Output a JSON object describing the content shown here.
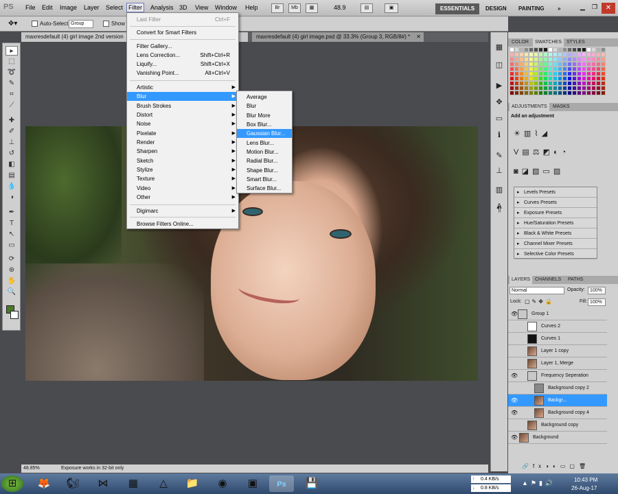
{
  "app": {
    "logo": "PS"
  },
  "menu": [
    "File",
    "Edit",
    "Image",
    "Layer",
    "Select",
    "Filter",
    "Analysis",
    "3D",
    "View",
    "Window",
    "Help"
  ],
  "menubar_right": {
    "br": "Br",
    "mb": "Mb",
    "zoom": "48.9",
    "workspaces": [
      "ESSENTIALS",
      "DESIGN",
      "PAINTING",
      "»"
    ]
  },
  "options": {
    "auto_select_label": "Auto-Select:",
    "auto_select_value": "Group",
    "show_label": "Show T"
  },
  "tabs": [
    {
      "label": "maxresdefault (4) girl image 2nd version"
    },
    {
      "label": "maxresdefault (4) girl image.psd @ 33.3% (Group 3, RGB/8#) *"
    }
  ],
  "filter_menu": {
    "items": [
      {
        "label": "Last Filter",
        "shortcut": "Ctrl+F"
      },
      {
        "label": "Convert for Smart Filters"
      },
      {
        "label": "Filter Gallery..."
      },
      {
        "label": "Lens Correction...",
        "shortcut": "Shift+Ctrl+R"
      },
      {
        "label": "Liquify...",
        "shortcut": "Shift+Ctrl+X"
      },
      {
        "label": "Vanishing Point...",
        "shortcut": "Alt+Ctrl+V"
      },
      {
        "label": "Artistic"
      },
      {
        "label": "Blur"
      },
      {
        "label": "Brush Strokes"
      },
      {
        "label": "Distort"
      },
      {
        "label": "Noise"
      },
      {
        "label": "Pixelate"
      },
      {
        "label": "Render"
      },
      {
        "label": "Sharpen"
      },
      {
        "label": "Sketch"
      },
      {
        "label": "Stylize"
      },
      {
        "label": "Texture"
      },
      {
        "label": "Video"
      },
      {
        "label": "Other"
      },
      {
        "label": "Digimarc"
      },
      {
        "label": "Browse Filters Online..."
      }
    ]
  },
  "blur_menu": [
    "Average",
    "Blur",
    "Blur More",
    "Box Blur...",
    "Gaussian Blur...",
    "Lens Blur...",
    "Motion Blur...",
    "Radial Blur...",
    "Shape Blur...",
    "Smart Blur...",
    "Surface Blur..."
  ],
  "panels": {
    "color_tabs": [
      "COLOR",
      "SWATCHES",
      "STYLES"
    ],
    "adj_tabs": [
      "ADJUSTMENTS",
      "MASKS"
    ],
    "add_adjustment": "Add an adjustment",
    "presets": [
      "Levels Presets",
      "Curves Presets",
      "Exposure Presets",
      "Hue/Saturation Presets",
      "Black & White Presets",
      "Channel Mixer Presets",
      "Selective Color Presets"
    ],
    "layer_tabs": [
      "LAYERS",
      "CHANNELS",
      "PATHS"
    ],
    "blend_mode": "Normal",
    "opacity_label": "Opacity:",
    "opacity": "100%",
    "lock_label": "Lock:",
    "fill_label": "Fill:",
    "fill": "100%",
    "layers": [
      {
        "name": "Group 1"
      },
      {
        "name": "Curves 2"
      },
      {
        "name": "Curves 1"
      },
      {
        "name": "Layer 1 copy"
      },
      {
        "name": "Layer 1, Merge"
      },
      {
        "name": "Frequency Seperation"
      },
      {
        "name": "Background copy 2"
      },
      {
        "name": "Backgr..."
      },
      {
        "name": "Background copy 4"
      },
      {
        "name": "Background copy"
      },
      {
        "name": "Background"
      }
    ]
  },
  "status": {
    "zoom": "48.85%",
    "message": "Exposure works in 32-bit only"
  },
  "taskbar": {
    "net_up": "0.4 KB/s",
    "net_down": "0.8 KB/s",
    "time": "10:43 PM",
    "date": "26-Aug-17"
  },
  "colors": {
    "highlight": "#3399ff",
    "menubar": "#c9c9c9",
    "canvas_bg": "#4a4b4f"
  }
}
